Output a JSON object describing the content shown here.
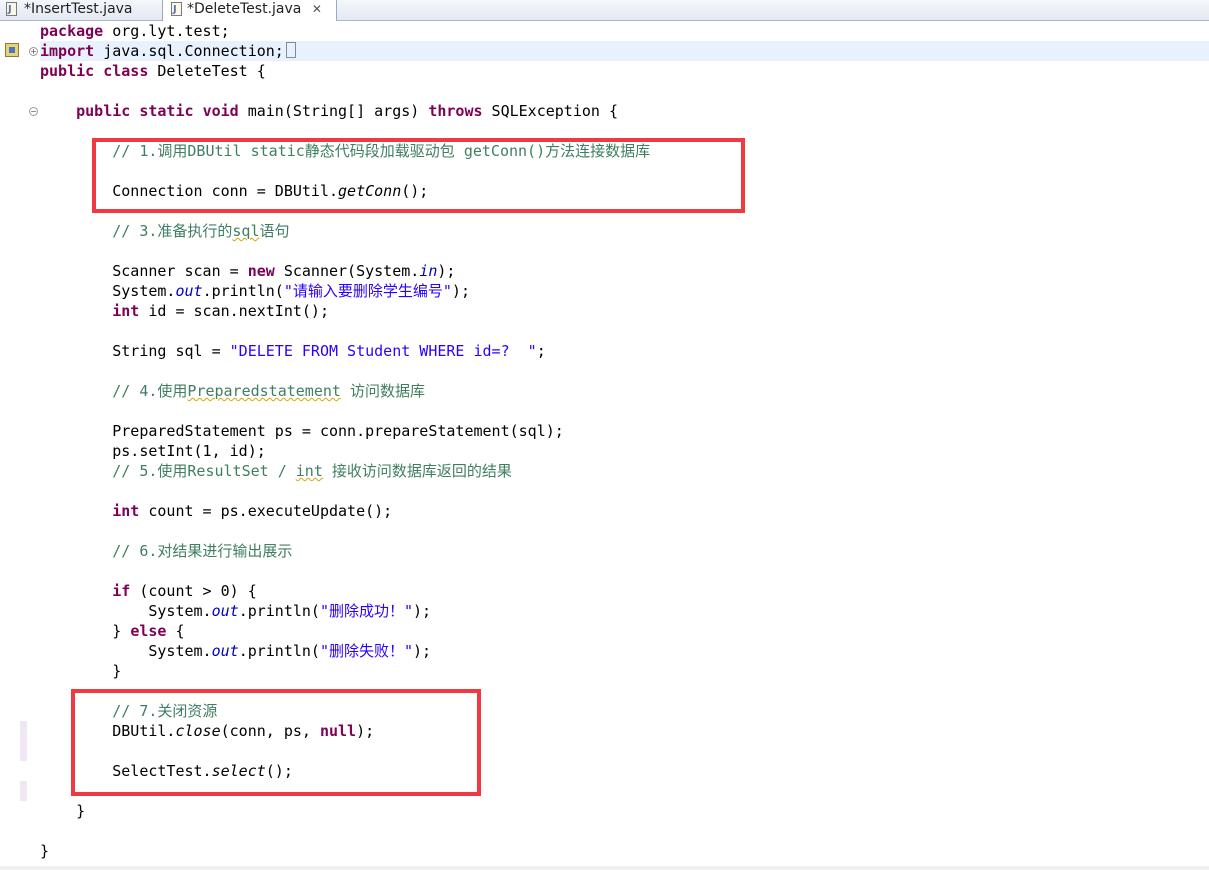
{
  "tabs": [
    {
      "label": "*InsertTest.java",
      "active": false
    },
    {
      "label": "*DeleteTest.java",
      "active": true,
      "close_glyph": "✕"
    }
  ],
  "code": {
    "l1_kw": "package",
    "l1_rest": " org.lyt.test;",
    "l2_kw": "import",
    "l2_rest": " java.sql.Connection;",
    "l3_kw1": "public",
    "l3_kw2": "class",
    "l3_rest": " DeleteTest {",
    "l5_kw1": "public",
    "l5_kw2": "static",
    "l5_kw3": "void",
    "l5_mid": " main(String[] args) ",
    "l5_kw4": "throws",
    "l5_rest": " SQLException {",
    "c1": "// 1.调用DBUtil static静态代码段加载驱动包 getConn()方法连接数据库",
    "l9_a": "Connection conn = DBUtil.",
    "l9_m": "getConn",
    "l9_b": "();",
    "c3_a": "// 3.准备执行的",
    "c3_sq": "sql",
    "c3_b": "语句",
    "l13_a": "Scanner scan = ",
    "l13_kw": "new",
    "l13_b": " Scanner(System.",
    "l13_f": "in",
    "l13_c": ");",
    "l14_a": "System.",
    "l14_f": "out",
    "l14_b": ".println(",
    "l14_s": "\"请输入要删除学生编号\"",
    "l14_c": ");",
    "l15_kw": "int",
    "l15_rest": " id = scan.nextInt();",
    "l17_a": "String sql = ",
    "l17_s": "\"DELETE FROM Student WHERE id=?  \"",
    "l17_c": ";",
    "c4_a": "// 4.使用",
    "c4_sq": "Preparedstatement",
    "c4_b": " 访问数据库",
    "l21": "PreparedStatement ps = conn.prepareStatement(sql);",
    "l22": "ps.setInt(1, id);",
    "c5_a": "// 5.使用ResultSet / ",
    "c5_sq": "int",
    "c5_b": " 接收访问数据库返回的结果",
    "l25_kw": "int",
    "l25_rest": " count = ps.executeUpdate();",
    "c6": "// 6.对结果进行输出展示",
    "l29_kw": "if",
    "l29_rest": " (count > 0) {",
    "l30_a": "System.",
    "l30_f": "out",
    "l30_b": ".println(",
    "l30_s": "\"删除成功！\"",
    "l30_c": ");",
    "l31_a": "} ",
    "l31_kw": "else",
    "l31_b": " {",
    "l32_a": "System.",
    "l32_f": "out",
    "l32_b": ".println(",
    "l32_s": "\"删除失败！\"",
    "l32_c": ");",
    "l33": "}",
    "c7": "// 7.关闭资源",
    "l36_a": "DBUtil.",
    "l36_m": "close",
    "l36_b": "(conn, ps, ",
    "l36_kw": "null",
    "l36_c": ");",
    "l38_a": "SelectTest.",
    "l38_m": "select",
    "l38_b": "();",
    "l40": "}",
    "l42": "}"
  },
  "colors": {
    "keyword": "#7f0055",
    "comment": "#3f7f5f",
    "string": "#2a00ff",
    "field": "#0000c0",
    "highlight_box": "#ee3a40",
    "current_line": "#e8f2fe"
  },
  "icons": [
    "java-file-icon",
    "close-icon",
    "annotation-marker-icon",
    "fold-expand-icon",
    "fold-collapse-icon"
  ]
}
